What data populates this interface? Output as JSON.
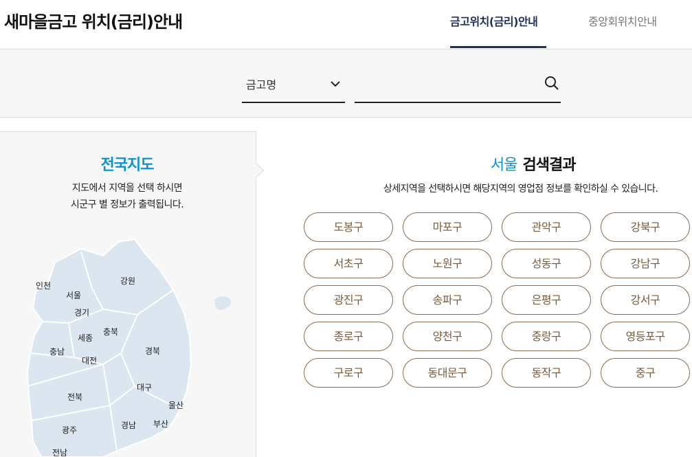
{
  "header": {
    "title": "새마을금고 위치(금리)안내",
    "tabs": [
      {
        "label": "금고위치(금리)안내",
        "active": true
      },
      {
        "label": "중앙회위치안내",
        "active": false
      }
    ]
  },
  "search": {
    "select_value": "금고명",
    "input_value": "",
    "placeholder": ""
  },
  "map_panel": {
    "title": "전국지도",
    "desc_line1": "지도에서 지역을 선택 하시면",
    "desc_line2": "시군구 별 정보가 출력됩니다.",
    "regions": [
      "인천",
      "서울",
      "경기",
      "강원",
      "충북",
      "세종",
      "충남",
      "대전",
      "경북",
      "대구",
      "울산",
      "전북",
      "경남",
      "부산",
      "광주",
      "전남"
    ]
  },
  "results": {
    "city": "서울",
    "title_rest": "검색결과",
    "desc": "상세지역을 선택하시면 해당지역의 영업점 정보를 확인하실 수 있습니다.",
    "districts": [
      "도봉구",
      "마포구",
      "관악구",
      "강북구",
      "서초구",
      "노원구",
      "성동구",
      "강남구",
      "광진구",
      "송파구",
      "은평구",
      "강서구",
      "종로구",
      "양천구",
      "중랑구",
      "영등포구",
      "구로구",
      "동대문구",
      "동작구",
      "중구"
    ]
  },
  "colors": {
    "accent_blue": "#0a94cf",
    "nav_dark": "#1d2f5b",
    "button_brown": "#7a5a3c",
    "map_fill": "#dbe6f1"
  }
}
